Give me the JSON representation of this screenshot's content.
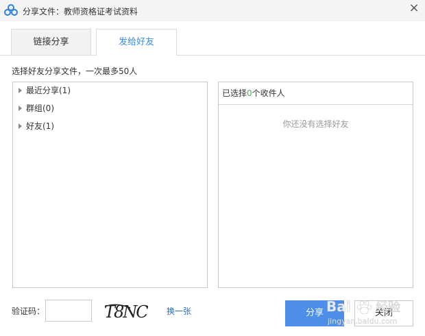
{
  "window": {
    "title": "分享文件：教师资格证考试资料",
    "close_glyph": "×",
    "logo_icon": "baidu-cloud-logo"
  },
  "tabs": [
    {
      "label": "链接分享",
      "active": false
    },
    {
      "label": "发给好友",
      "active": true
    }
  ],
  "hint": "选择好友分享文件，一次最多50人",
  "tree": [
    {
      "label": "最近分享(1)"
    },
    {
      "label": "群组(0)"
    },
    {
      "label": "好友(1)"
    }
  ],
  "selected": {
    "prefix": "已选择",
    "count": "0",
    "suffix": "个收件人",
    "empty_message": "你还没有选择好友"
  },
  "captcha": {
    "label": "验证码：",
    "input_value": "",
    "image_text": "T8NC",
    "refresh_label": "换一张"
  },
  "buttons": {
    "share": "分享",
    "close": "关闭"
  },
  "watermark": {
    "brand": "Bai",
    "brand2": "经验",
    "domain": "jingyan.baidu.com"
  },
  "colors": {
    "accent": "#4d8fe8",
    "link": "#2b6fc2",
    "count": "#4caf50"
  }
}
